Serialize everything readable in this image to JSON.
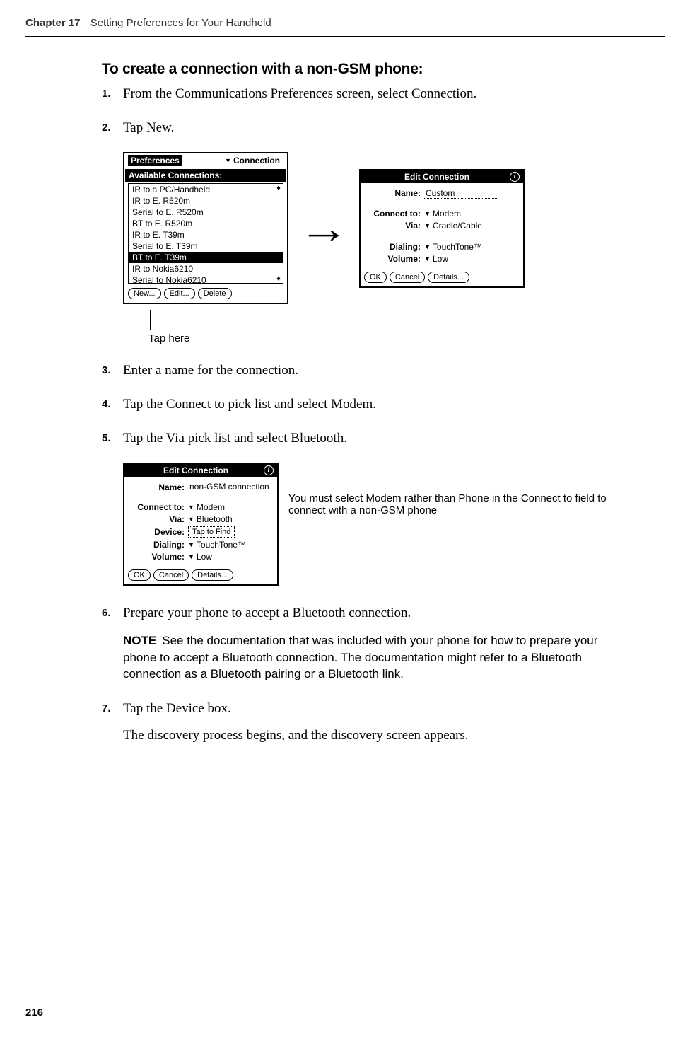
{
  "header": {
    "chapter": "Chapter 17",
    "title": "Setting Preferences for Your Handheld"
  },
  "section_title": "To create a connection with a non-GSM phone:",
  "steps": {
    "s1": {
      "num": "1.",
      "text": "From the Communications Preferences screen, select Connection."
    },
    "s2": {
      "num": "2.",
      "text": "Tap New."
    },
    "s3": {
      "num": "3.",
      "text": "Enter a name for the connection."
    },
    "s4": {
      "num": "4.",
      "text": "Tap the Connect to pick list and select Modem."
    },
    "s5": {
      "num": "5.",
      "text": "Tap the Via pick list and select Bluetooth."
    },
    "s6": {
      "num": "6.",
      "text": "Prepare your phone to accept a Bluetooth connection."
    },
    "s7": {
      "num": "7.",
      "text": "Tap the Device box.",
      "sub": "The discovery process begins, and the discovery screen appears."
    }
  },
  "note": {
    "label": "NOTE",
    "text": "See the documentation that was included with your phone for how to prepare your phone to accept a Bluetooth connection. The documentation might refer to a Bluetooth connection as a Bluetooth pairing or a Bluetooth link."
  },
  "tap_here": "Tap here",
  "callout_modem": "You must select Modem rather than Phone in the Connect to field to connect with a non-GSM phone",
  "fig1_prefs": {
    "title": "Preferences",
    "picklist": "Connection",
    "subtitle": "Available Connections:",
    "items": [
      "IR to a PC/Handheld",
      "IR to E. R520m",
      "Serial to E. R520m",
      "BT to E. R520m",
      "IR to E. T39m",
      "Serial to E. T39m",
      "BT to E. T39m",
      "IR to Nokia6210",
      "Serial to Nokia6210"
    ],
    "selected_index": 6,
    "btn_new": "New...",
    "btn_edit": "Edit...",
    "btn_delete": "Delete"
  },
  "fig1_edit": {
    "title": "Edit Connection",
    "name_label": "Name:",
    "name_value": "Custom",
    "connect_label": "Connect to:",
    "connect_value": "Modem",
    "via_label": "Via:",
    "via_value": "Cradle/Cable",
    "dialing_label": "Dialing:",
    "dialing_value": "TouchTone™",
    "volume_label": "Volume:",
    "volume_value": "Low",
    "btn_ok": "OK",
    "btn_cancel": "Cancel",
    "btn_details": "Details..."
  },
  "fig2_edit": {
    "title": "Edit Connection",
    "name_label": "Name:",
    "name_value": "non-GSM connection",
    "connect_label": "Connect to:",
    "connect_value": "Modem",
    "via_label": "Via:",
    "via_value": "Bluetooth",
    "device_label": "Device:",
    "device_value": "Tap to Find",
    "dialing_label": "Dialing:",
    "dialing_value": "TouchTone™",
    "volume_label": "Volume:",
    "volume_value": "Low",
    "btn_ok": "OK",
    "btn_cancel": "Cancel",
    "btn_details": "Details..."
  },
  "page_number": "216"
}
